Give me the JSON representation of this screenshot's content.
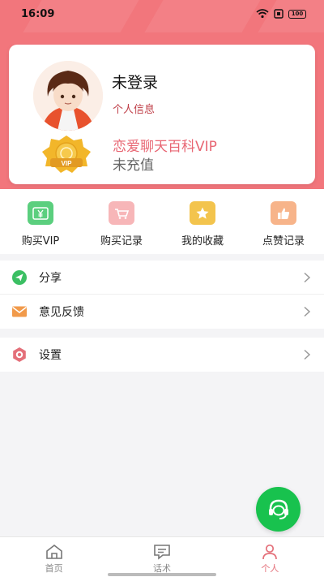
{
  "status_bar": {
    "time": "16:09",
    "battery": "100"
  },
  "profile": {
    "name": "未登录",
    "info_link": "个人信息",
    "vip_badge_text": "VIP",
    "vip_title": "恋爱聊天百科VIP",
    "vip_status": "未充值"
  },
  "quick_menu": [
    {
      "label": "购买VIP",
      "icon": "yuan-icon",
      "color": "#5bcf7e"
    },
    {
      "label": "购买记录",
      "icon": "cart-icon",
      "color": "#f7b6b8"
    },
    {
      "label": "我的收藏",
      "icon": "star-icon",
      "color": "#f3c44d"
    },
    {
      "label": "点赞记录",
      "icon": "thumbs-up-icon",
      "color": "#f7b48a"
    }
  ],
  "list_group_1": [
    {
      "label": "分享",
      "icon": "share-icon",
      "color": "#3bbf63"
    },
    {
      "label": "意见反馈",
      "icon": "mail-icon",
      "color": "#f19a4a"
    }
  ],
  "list_group_2": [
    {
      "label": "设置",
      "icon": "settings-icon",
      "color": "#e4707a"
    }
  ],
  "tab_bar": [
    {
      "label": "首页",
      "icon": "home-icon",
      "active": false
    },
    {
      "label": "话术",
      "icon": "chat-icon",
      "active": false
    },
    {
      "label": "个人",
      "icon": "person-icon",
      "active": true
    }
  ],
  "colors": {
    "header": "#f2767c",
    "accent": "#e4707a",
    "fab": "#18c24e"
  }
}
